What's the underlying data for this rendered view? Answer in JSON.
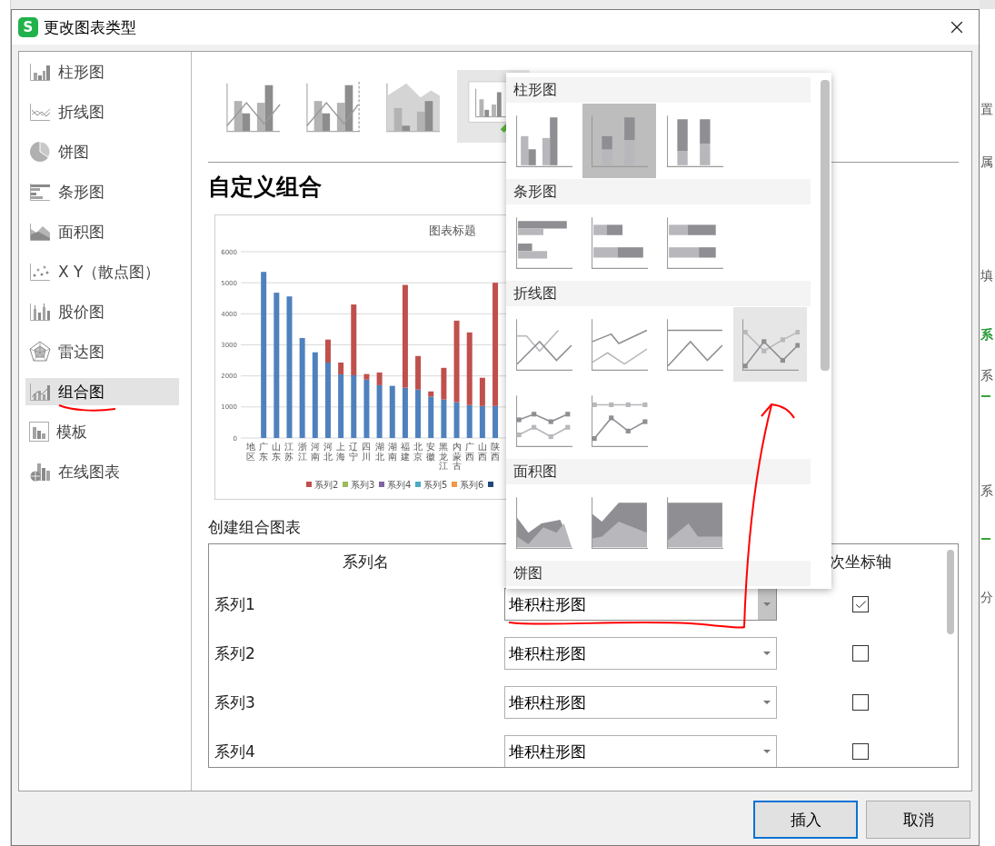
{
  "window": {
    "app_icon_letter": "S",
    "title": "更改图表类型"
  },
  "app_background": {
    "right_edge": [
      {
        "text": "置",
        "emphasis": false
      },
      {
        "text": "属",
        "emphasis": false
      },
      {
        "text": "填",
        "emphasis": false
      },
      {
        "text": "系",
        "emphasis": true
      },
      {
        "text": "系",
        "emphasis": false
      },
      {
        "text": "系",
        "emphasis": false
      },
      {
        "text": "分",
        "emphasis": false
      }
    ]
  },
  "sidebar": {
    "items": [
      {
        "kind": "column",
        "label": "柱形图",
        "selected": false
      },
      {
        "kind": "line",
        "label": "折线图",
        "selected": false
      },
      {
        "kind": "pie",
        "label": "饼图",
        "selected": false
      },
      {
        "kind": "bar",
        "label": "条形图",
        "selected": false
      },
      {
        "kind": "area",
        "label": "面积图",
        "selected": false
      },
      {
        "kind": "scatter",
        "label": "X Y（散点图）",
        "selected": false
      },
      {
        "kind": "stock",
        "label": "股价图",
        "selected": false
      },
      {
        "kind": "radar",
        "label": "雷达图",
        "selected": false
      },
      {
        "kind": "combo",
        "label": "组合图",
        "selected": true
      },
      {
        "kind": "template",
        "label": "模板",
        "selected": false
      },
      {
        "kind": "online",
        "label": "在线图表",
        "selected": false
      }
    ]
  },
  "chart_types": [
    {
      "kind": "combo-line-column",
      "selected": false
    },
    {
      "kind": "combo-line-column-secondary",
      "selected": false
    },
    {
      "kind": "combo-area-column",
      "selected": false
    },
    {
      "kind": "custom",
      "selected": true
    }
  ],
  "section_title": "自定义组合",
  "preview": {
    "legend": [
      {
        "label": "系列2",
        "color": "#c0504d"
      },
      {
        "label": "系列3",
        "color": "#9bbb59"
      },
      {
        "label": "系列4",
        "color": "#8064a2"
      },
      {
        "label": "系列5",
        "color": "#4bacc6"
      },
      {
        "label": "系列6",
        "color": "#f79646"
      },
      {
        "color": "#1f497d"
      }
    ],
    "chart_data": {
      "type": "bar",
      "title": "图表标题",
      "stacked": true,
      "grid": true,
      "ylim": [
        0,
        6000
      ],
      "yticks": [
        0,
        1000,
        2000,
        3000,
        4000,
        5000,
        6000
      ],
      "categories": [
        "地区",
        "广东",
        "山东",
        "江苏",
        "浙江",
        "河南",
        "河北",
        "上海",
        "辽宁",
        "四川",
        "湖北",
        "湖南",
        "福建",
        "北京",
        "安徽",
        "黑龙江",
        "内蒙古",
        "广西",
        "山西",
        "陕西"
      ],
      "series": [
        {
          "color": "#4f81bd",
          "values": [
            null,
            5350,
            4680,
            4560,
            3220,
            2760,
            2430,
            2050,
            2020,
            1880,
            1700,
            1680,
            1620,
            1560,
            1330,
            1240,
            1150,
            1060,
            1030,
            1030
          ]
        },
        {
          "color": "#c0504d",
          "values": [
            null,
            null,
            null,
            null,
            null,
            null,
            740,
            380,
            2280,
            180,
            410,
            null,
            3310,
            1080,
            170,
            1020,
            2630,
            2340,
            910,
            3970
          ]
        }
      ]
    }
  },
  "combo": {
    "title": "创建组合图表",
    "name_header": "系列名",
    "axis_header": "次坐标轴",
    "rows": [
      {
        "name": "系列1",
        "type": "堆积柱形图",
        "secondary_axis": true,
        "open": true
      },
      {
        "name": "系列2",
        "type": "堆积柱形图",
        "secondary_axis": false,
        "open": false
      },
      {
        "name": "系列3",
        "type": "堆积柱形图",
        "secondary_axis": false,
        "open": false
      },
      {
        "name": "系列4",
        "type": "堆积柱形图",
        "secondary_axis": false,
        "open": false
      }
    ]
  },
  "type_menu": {
    "sections": [
      {
        "title": "柱形图",
        "items": [
          {
            "kind": "clustered-column",
            "selected": false,
            "hovered": false
          },
          {
            "kind": "stacked-column",
            "selected": true,
            "hovered": false
          },
          {
            "kind": "percent-column",
            "selected": false,
            "hovered": false
          }
        ]
      },
      {
        "title": "条形图",
        "items": [
          {
            "kind": "clustered-bar",
            "selected": false,
            "hovered": false
          },
          {
            "kind": "stacked-bar",
            "selected": false,
            "hovered": false
          },
          {
            "kind": "percent-bar",
            "selected": false,
            "hovered": false
          }
        ]
      },
      {
        "title": "折线图",
        "items": [
          {
            "kind": "line",
            "selected": false,
            "hovered": false
          },
          {
            "kind": "stacked-line",
            "selected": false,
            "hovered": false
          },
          {
            "kind": "percent-line",
            "selected": false,
            "hovered": false
          },
          {
            "kind": "line-markers",
            "selected": false,
            "hovered": true
          },
          {
            "kind": "stacked-line-markers",
            "selected": false,
            "hovered": false
          },
          {
            "kind": "percent-line-markers",
            "selected": false,
            "hovered": false
          }
        ]
      },
      {
        "title": "面积图",
        "items": [
          {
            "kind": "area",
            "selected": false,
            "hovered": false
          },
          {
            "kind": "stacked-area",
            "selected": false,
            "hovered": false
          },
          {
            "kind": "percent-area",
            "selected": false,
            "hovered": false
          }
        ]
      },
      {
        "title": "饼图"
      }
    ]
  },
  "buttons": [
    {
      "label": "插入",
      "default": true
    },
    {
      "label": "取消",
      "default": false
    }
  ]
}
